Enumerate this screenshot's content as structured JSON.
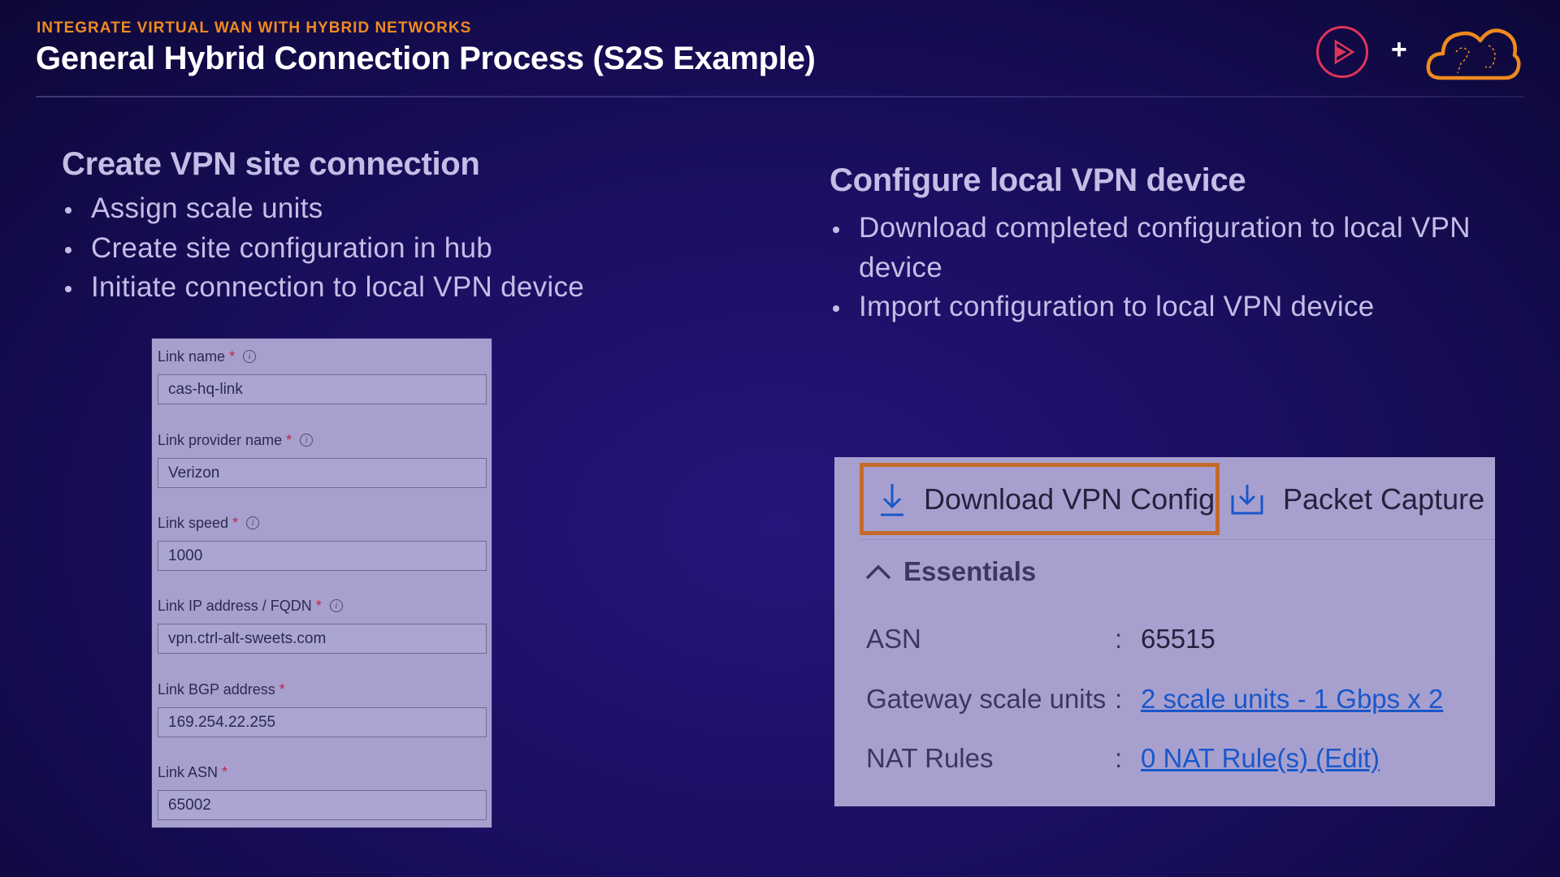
{
  "header": {
    "eyebrow": "INTEGRATE VIRTUAL WAN WITH HYBRID NETWORKS",
    "title": "General Hybrid Connection Process (S2S Example)"
  },
  "brand": {
    "play_icon": "play-circle-icon",
    "plus": "+",
    "cloud_icon": "cloud-icon",
    "colors": {
      "accent_orange": "#f08a1e",
      "play_red": "#e0345a"
    }
  },
  "left": {
    "heading": "Create VPN site connection",
    "bullets": [
      "Assign scale units",
      "Create site configuration in hub",
      "Initiate connection to local VPN device"
    ]
  },
  "right": {
    "heading": "Configure local VPN device",
    "bullets": [
      "Download completed configuration to local VPN device",
      "Import configuration to local VPN device"
    ]
  },
  "form": {
    "fields": [
      {
        "label": "Link name",
        "required": "*",
        "value": "cas-hq-link",
        "info": true
      },
      {
        "label": "Link provider name",
        "required": "*",
        "value": "Verizon",
        "info": true
      },
      {
        "label": "Link speed",
        "required": "*",
        "value": "1000",
        "info": true
      },
      {
        "label": "Link IP address / FQDN",
        "required": "*",
        "value": "vpn.ctrl-alt-sweets.com",
        "info": true
      },
      {
        "label": "Link BGP address",
        "required": "*",
        "value": "169.254.22.255",
        "info": false
      },
      {
        "label": "Link ASN",
        "required": "*",
        "value": "65002",
        "info": false
      }
    ]
  },
  "vpn": {
    "download_label": "Download VPN Config",
    "packet_capture_label": "Packet Capture",
    "essentials_label": "Essentials",
    "rows": [
      {
        "key": "ASN",
        "value": "65515",
        "link": false
      },
      {
        "key": "Gateway scale units",
        "value": "2 scale units - 1 Gbps x 2",
        "link": true
      },
      {
        "key": "NAT Rules",
        "value": "0 NAT Rule(s) (Edit)",
        "link": true
      }
    ],
    "colon": ":"
  }
}
